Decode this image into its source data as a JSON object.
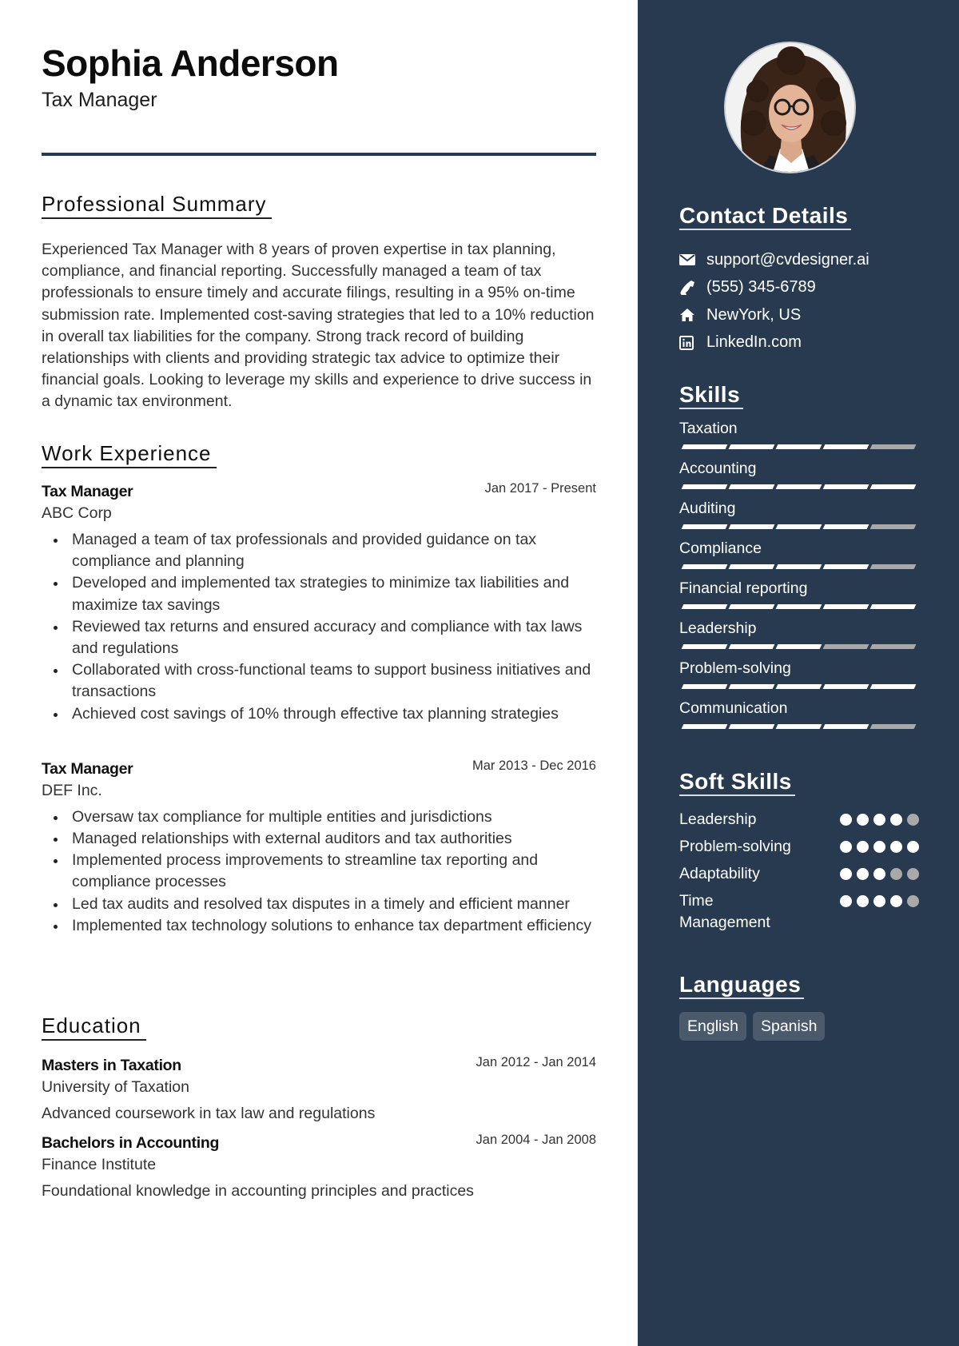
{
  "header": {
    "name": "Sophia Anderson",
    "title": "Tax Manager"
  },
  "summary": {
    "heading": "Professional Summary",
    "text": "Experienced Tax Manager with 8 years of proven expertise in tax planning, compliance, and financial reporting. Successfully managed a team of tax professionals to ensure timely and accurate filings, resulting in a 95% on-time submission rate. Implemented cost-saving strategies that led to a 10% reduction in overall tax liabilities for the company. Strong track record of building relationships with clients and providing strategic tax advice to optimize their financial goals. Looking to leverage my skills and experience to drive success in a dynamic tax environment."
  },
  "work": {
    "heading": "Work Experience",
    "jobs": [
      {
        "role": "Tax Manager",
        "company": "ABC Corp",
        "dates": "Jan 2017 - Present",
        "bullets": [
          "Managed a team of tax professionals and provided guidance on tax compliance and planning",
          "Developed and implemented tax strategies to minimize tax liabilities and maximize tax savings",
          "Reviewed tax returns and ensured accuracy and compliance with tax laws and regulations",
          "Collaborated with cross-functional teams to support business initiatives and transactions",
          "Achieved cost savings of 10% through effective tax planning strategies"
        ]
      },
      {
        "role": "Tax Manager",
        "company": "DEF Inc.",
        "dates": "Mar 2013 - Dec 2016",
        "bullets": [
          "Oversaw tax compliance for multiple entities and jurisdictions",
          "Managed relationships with external auditors and tax authorities",
          "Implemented process improvements to streamline tax reporting and compliance processes",
          "Led tax audits and resolved tax disputes in a timely and efficient manner",
          "Implemented tax technology solutions to enhance tax department efficiency"
        ]
      }
    ]
  },
  "education": {
    "heading": "Education",
    "items": [
      {
        "degree": "Masters in Taxation",
        "school": "University of Taxation",
        "dates": "Jan 2012 - Jan 2014",
        "description": "Advanced coursework in tax law and regulations"
      },
      {
        "degree": "Bachelors in Accounting",
        "school": "Finance Institute",
        "dates": "Jan 2004 - Jan 2008",
        "description": "Foundational knowledge in accounting principles and practices"
      }
    ]
  },
  "sidebar": {
    "photo_alt": "Profile photo of Sophia Anderson",
    "contact": {
      "heading": "Contact Details",
      "items": [
        {
          "icon": "envelope-icon",
          "text": "support@cvdesigner.ai"
        },
        {
          "icon": "phone-icon",
          "text": "(555) 345-6789"
        },
        {
          "icon": "home-icon",
          "text": "NewYork, US"
        },
        {
          "icon": "linkedin-icon",
          "text": "LinkedIn.com"
        }
      ]
    },
    "skills": {
      "heading": "Skills",
      "max": 5,
      "items": [
        {
          "name": "Taxation",
          "level": 4
        },
        {
          "name": "Accounting",
          "level": 5
        },
        {
          "name": "Auditing",
          "level": 4
        },
        {
          "name": "Compliance",
          "level": 4
        },
        {
          "name": "Financial reporting",
          "level": 5
        },
        {
          "name": "Leadership",
          "level": 3
        },
        {
          "name": "Problem-solving",
          "level": 5
        },
        {
          "name": "Communication",
          "level": 4
        }
      ]
    },
    "soft_skills": {
      "heading": "Soft Skills",
      "max": 5,
      "items": [
        {
          "name": "Leadership",
          "level": 4
        },
        {
          "name": "Problem-solving",
          "level": 5
        },
        {
          "name": "Adaptability",
          "level": 3
        },
        {
          "name": "Time Management",
          "level": 4
        }
      ]
    },
    "languages": {
      "heading": "Languages",
      "items": [
        "English",
        "Spanish"
      ]
    }
  },
  "colors": {
    "sidebar_bg": "#283a4f",
    "accent": "#283a4f",
    "rating_on": "#ffffff",
    "rating_off": "#a9a9a9",
    "language_tag_bg": "#4a5a6b"
  }
}
